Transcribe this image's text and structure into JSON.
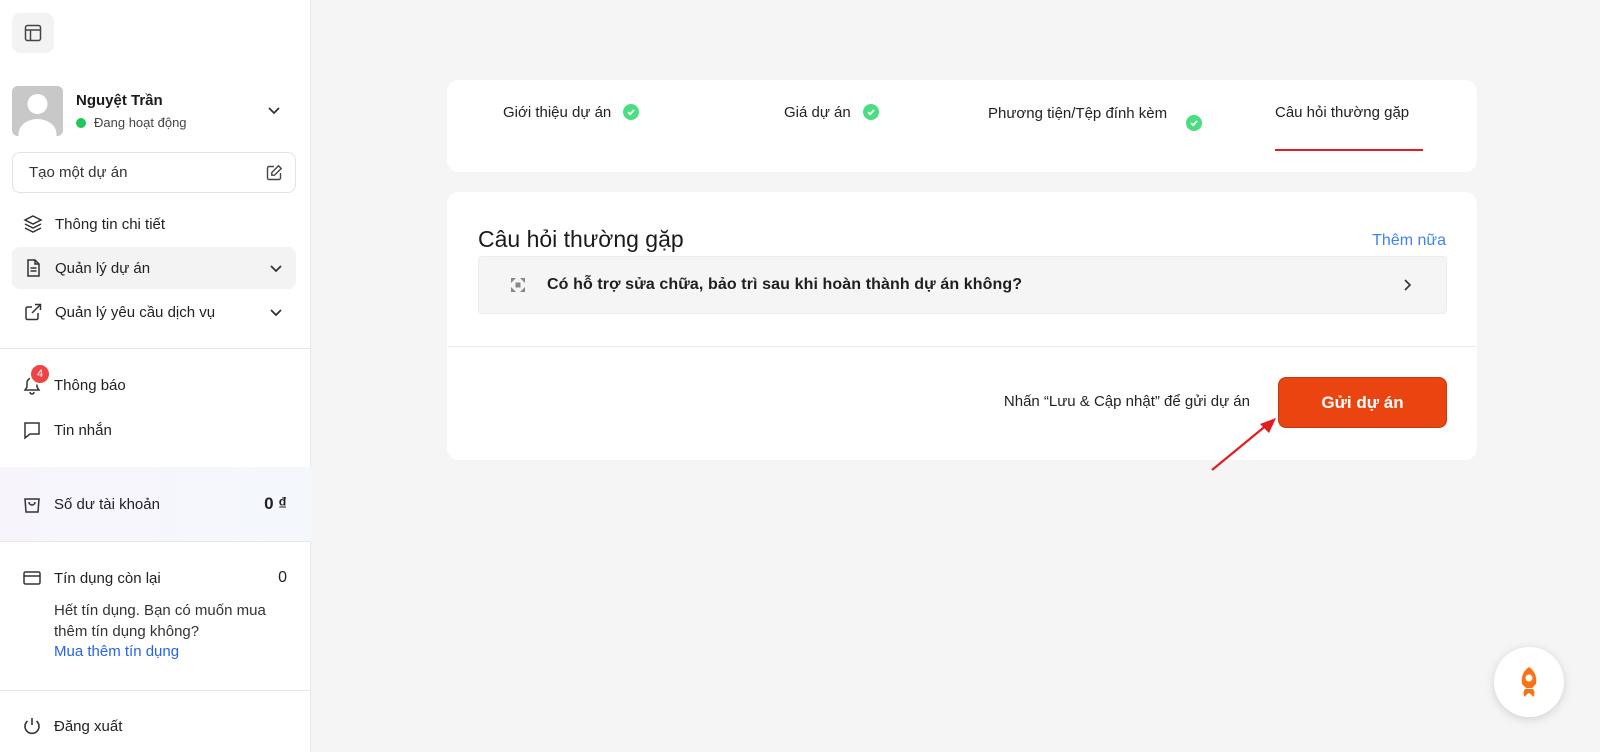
{
  "sidebar": {
    "user": {
      "name": "Nguyệt Trần",
      "status": "Đang hoạt động"
    },
    "create_label": "Tạo một dự án",
    "nav": [
      {
        "label": "Thông tin chi tiết"
      },
      {
        "label": "Quản lý dự án"
      },
      {
        "label": "Quản lý yêu cầu dịch vụ"
      }
    ],
    "notifications": {
      "label": "Thông báo",
      "count": "4"
    },
    "messages": {
      "label": "Tin nhắn"
    },
    "balance": {
      "label": "Số dư tài khoản",
      "value": "0 ₫"
    },
    "credit": {
      "label": "Tín dụng còn lại",
      "value": "0",
      "note": "Hết tín dụng. Bạn có muốn mua thêm tín dụng không?",
      "link": "Mua thêm tín dụng"
    },
    "logout": "Đăng xuất"
  },
  "steps": [
    {
      "label": "Giới thiệu dự án",
      "done": true
    },
    {
      "label": "Giá dự án",
      "done": true
    },
    {
      "label": "Phương tiện/Tệp đính kèm",
      "done": true
    },
    {
      "label": "Câu hỏi thường gặp",
      "done": false,
      "active": true
    }
  ],
  "faq_section": {
    "title": "Câu hỏi thường gặp",
    "more": "Thêm nữa",
    "items": [
      {
        "question": "Có hỗ trợ sửa chữa, bảo trì sau khi hoàn thành dự án không?"
      }
    ]
  },
  "footer": {
    "hint": "Nhấn “Lưu & Cập nhật” để gửi dự án",
    "submit": "Gửi dự án"
  },
  "colors": {
    "accent": "#ea4411",
    "link": "#3b82f6",
    "success": "#4ade80",
    "active_tab": "#e11d1d",
    "badge": "#ef4444"
  }
}
